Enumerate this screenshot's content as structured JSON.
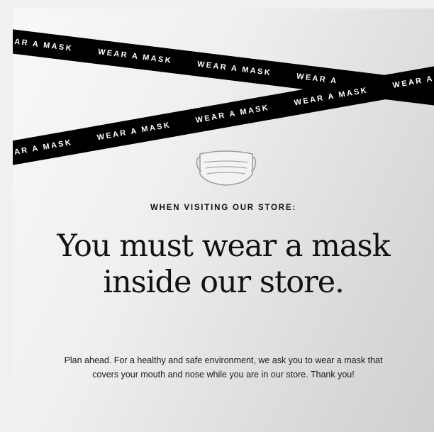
{
  "tape": {
    "top_items": [
      "WEAR A MASK",
      "WEAR A MASK",
      "WEAR A MASK",
      "WEAR A"
    ],
    "bottom_items": [
      "WEAR A MASK",
      "WEAR A MASK",
      "WEAR A MASK",
      "WEAR A MASK",
      "WEAR A"
    ]
  },
  "icon": {
    "name": "face-mask-icon"
  },
  "poster": {
    "eyebrow": "WHEN VISITING OUR STORE:",
    "headline": "You must wear a mask inside our store.",
    "body": "Plan ahead. For a healthy and safe environment, we ask you to wear a mask that covers your mouth and nose while you are in our store. Thank you!"
  },
  "colors": {
    "tape_background": "#000000",
    "tape_text": "#ffffff",
    "text_primary": "#111111",
    "page_background": "#f0f0f0"
  }
}
